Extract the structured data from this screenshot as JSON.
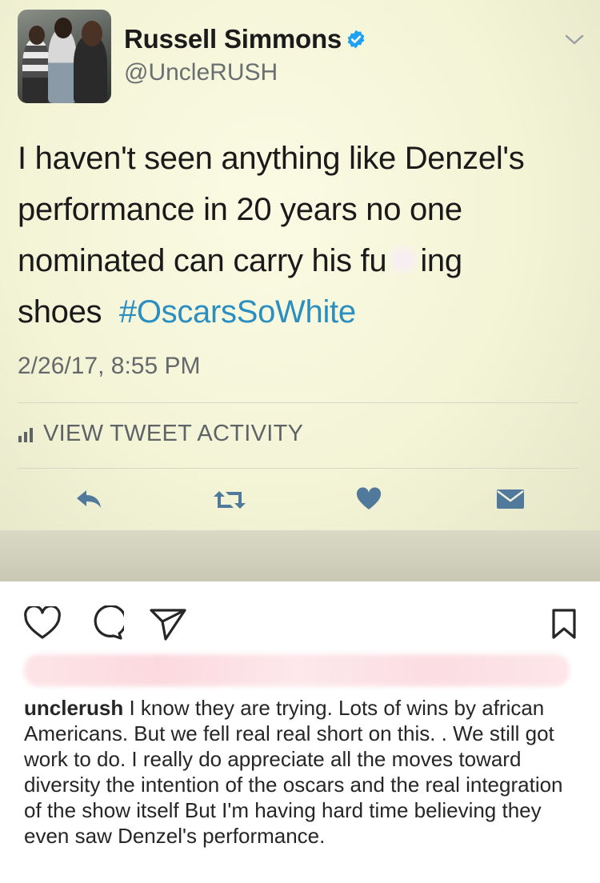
{
  "tweet": {
    "name": "Russell Simmons",
    "handle": "@UncleRUSH",
    "text_part1": "I haven't seen anything like Denzel's performance in 20 years no one nominated can carry his fu",
    "text_part2": "ing shoes",
    "hashtag": "#OscarsSoWhite",
    "timestamp": "2/26/17, 8:55 PM",
    "activity_label": "VIEW TWEET ACTIVITY",
    "colors": {
      "hashtag": "#2a8fc0",
      "verified": "#1da1f2",
      "action_icons": "#50799c"
    },
    "icons": [
      "verified-badge-icon",
      "chevron-down-icon",
      "bar-chart-icon",
      "reply-icon",
      "retweet-icon",
      "like-icon",
      "message-icon"
    ]
  },
  "instagram": {
    "icons": [
      "heart-icon",
      "comment-icon",
      "share-icon",
      "bookmark-icon"
    ],
    "caption_user": "unclerush",
    "caption_text": " I know they are trying.  Lots of wins by african Americans.  But we fell real real short on this. .  We still got work to do.  I really do appreciate all the moves toward diversity the intention of the oscars and the real integration  of the show itself But I'm having hard time believing they even saw Denzel's performance."
  }
}
